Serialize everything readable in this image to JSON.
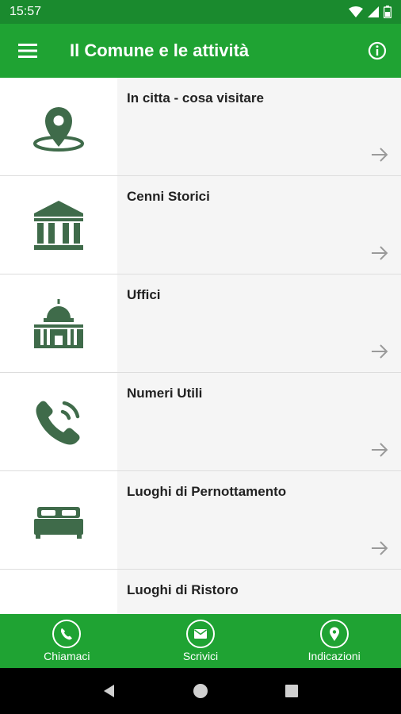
{
  "status_bar": {
    "time": "15:57"
  },
  "app_bar": {
    "title": "Il Comune e le attività"
  },
  "list": {
    "items": [
      {
        "label": "In citta - cosa visitare",
        "icon": "map-pin-icon"
      },
      {
        "label": "Cenni Storici",
        "icon": "museum-icon"
      },
      {
        "label": "Uffici",
        "icon": "town-hall-icon"
      },
      {
        "label": "Numeri Utili",
        "icon": "phone-ringing-icon"
      },
      {
        "label": "Luoghi di Pernottamento",
        "icon": "bed-icon"
      },
      {
        "label": "Luoghi di Ristoro",
        "icon": "cloche-icon"
      }
    ]
  },
  "bottom_bar": {
    "call_label": "Chiamaci",
    "write_label": "Scrivici",
    "directions_label": "Indicazioni"
  },
  "colors": {
    "status_bar": "#1a8a2e",
    "app_bar": "#1fa333",
    "icon_green": "#3f6b4a",
    "item_bg": "#f5f5f5"
  }
}
